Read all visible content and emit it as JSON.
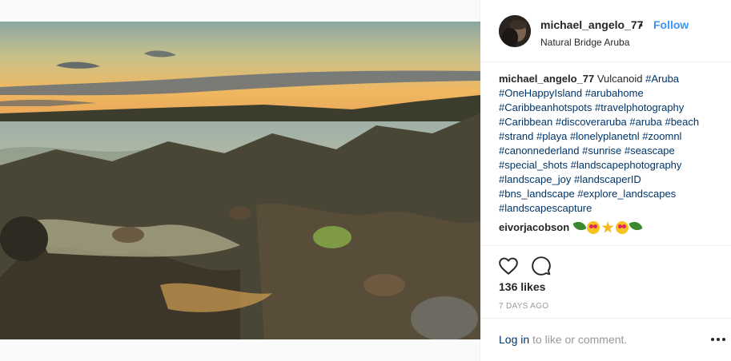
{
  "post": {
    "username": "michael_angelo_77",
    "separator": "•",
    "follow_label": "Follow",
    "location": "Natural Bridge Aruba",
    "caption_user": "michael_angelo_77",
    "caption_text": "Vulcanoid",
    "hashtags": [
      "#Aruba",
      "#OneHappyIsland",
      "#arubahome",
      "#Caribbeanhotspots",
      "#travelphotography",
      "#Caribbean",
      "#discoveraruba",
      "#aruba",
      "#beach",
      "#strand",
      "#playa",
      "#lonelyplanetnl",
      "#zoomnl",
      "#canonnederland",
      "#sunrise",
      "#seascape",
      "#special_shots",
      "#landscapephotography",
      "#landscape_joy",
      "#landscaperID",
      "#bns_landscape",
      "#explore_landscapes",
      "#landscapescapture"
    ],
    "comments": [
      {
        "user": "eivorjacobson",
        "emojis": [
          "leaf-emoji",
          "heart-eyes-emoji",
          "sparkle-emoji",
          "heart-eyes-emoji",
          "leaf-emoji"
        ]
      }
    ],
    "likes": "136 likes",
    "timestamp": "7 DAYS AGO",
    "login_link": "Log in",
    "login_rest": " to like or comment.",
    "icons": {
      "like": "heart-outline-icon",
      "comment": "speech-bubble-icon",
      "more": "more-options-icon"
    },
    "colors": {
      "link": "#003569",
      "follow": "#3897f0",
      "muted": "#999999"
    }
  }
}
